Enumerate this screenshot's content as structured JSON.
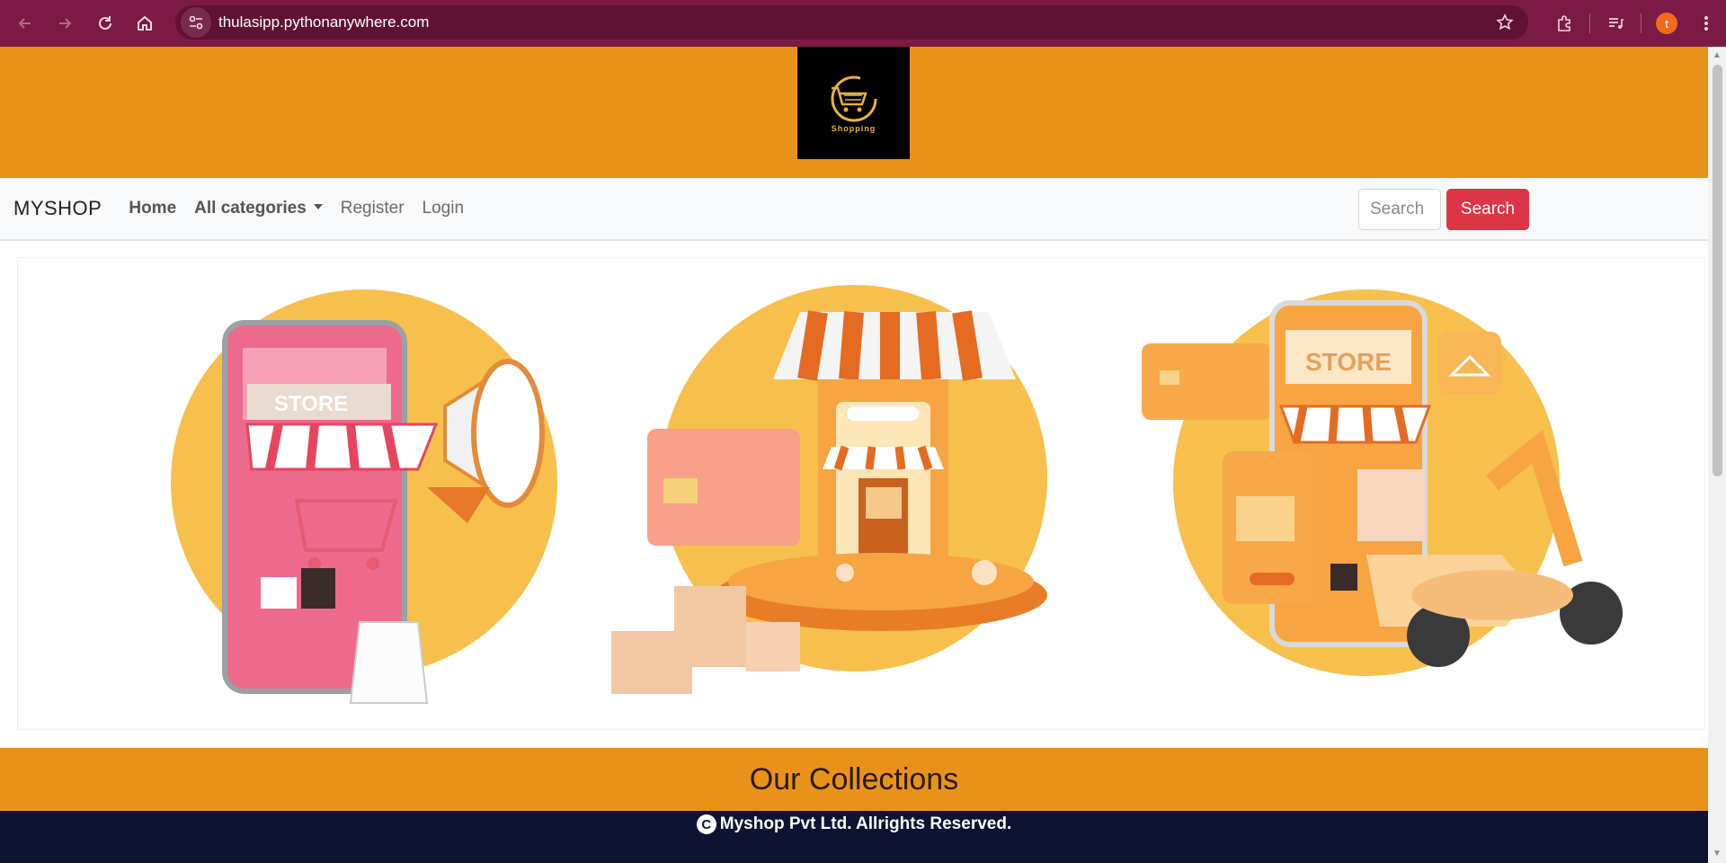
{
  "browser": {
    "url": "thulasipp.pythonanywhere.com",
    "profile_initial": "t",
    "icons": [
      "back-icon",
      "forward-icon",
      "reload-icon",
      "home-icon",
      "site-info-icon",
      "bookmark-star-icon",
      "extensions-icon",
      "reading-list-icon",
      "menu-icon"
    ]
  },
  "banner": {
    "logo_text": "Shopping",
    "background": "#e8921a"
  },
  "navbar": {
    "brand": "MYSHOP",
    "links": {
      "home": "Home",
      "categories": "All categories",
      "register": "Register",
      "login": "Login"
    },
    "search_value": "Search",
    "search_button": "Search"
  },
  "hero": {
    "illustrations": [
      "phone-store-megaphone",
      "storefront-boxes",
      "phone-store-scooter"
    ],
    "store_sign": "STORE"
  },
  "collections": {
    "title": "Our Collections"
  },
  "footer": {
    "copyright_symbol": "C",
    "text": "Myshop Pvt Ltd. Allrights Reserved."
  },
  "colors": {
    "chrome": "#7b1a44",
    "accent_orange": "#e8921a",
    "search_button": "#dc3545",
    "footer": "#0d1330"
  }
}
